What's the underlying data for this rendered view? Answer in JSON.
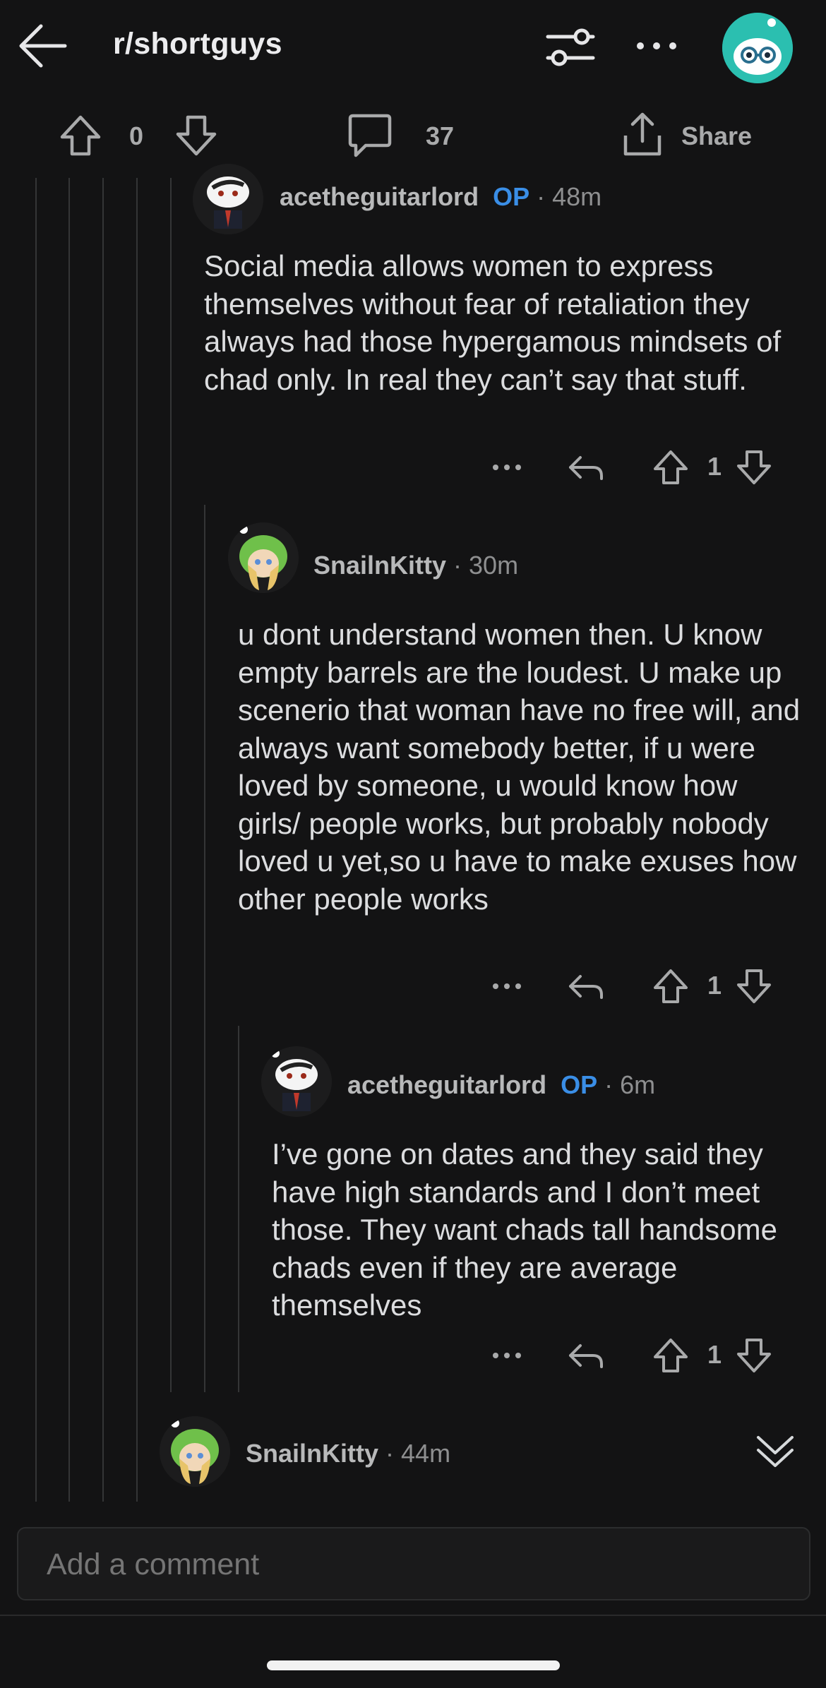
{
  "header": {
    "subreddit": "r/shortguys"
  },
  "post_actions": {
    "score": "0",
    "comment_count": "37",
    "share_label": "Share"
  },
  "comments": [
    {
      "user": "acetheguitarlord",
      "op_badge": "OP",
      "age": "48m",
      "body": "Social media allows women to express themselves without fear of retaliation they always had those hypergamous mindsets of chad only. In real they can’t say that stuff.",
      "score": "1"
    },
    {
      "user": "SnailnKitty",
      "age": "30m",
      "body": "u dont understand women then. U know empty barrels are the loudest. U make up scenerio that woman have no free will, and always want somebody better, if u were loved by someone, u would know how girls/ people works, but probably nobody loved u yet,so u have to make exuses how other people works",
      "score": "1"
    },
    {
      "user": "acetheguitarlord",
      "op_badge": "OP",
      "age": "6m",
      "body": "I’ve gone on dates and they said they have high standards and I don’t meet those. They want chads tall handsome chads even if they are average themselves",
      "score": "1"
    },
    {
      "user": "SnailnKitty",
      "age": "44m"
    }
  ],
  "composer": {
    "placeholder": "Add a comment"
  },
  "colors": {
    "background": "#131314",
    "op_badge": "#3a8ee6",
    "avatar_top_bg": "#2bbfb0"
  },
  "icons": [
    "back-arrow-icon",
    "filter-icon",
    "more-horizontal-icon",
    "user-avatar",
    "upvote-icon",
    "downvote-icon",
    "comment-icon",
    "share-icon",
    "reply-icon",
    "collapse-chevrons-icon"
  ]
}
